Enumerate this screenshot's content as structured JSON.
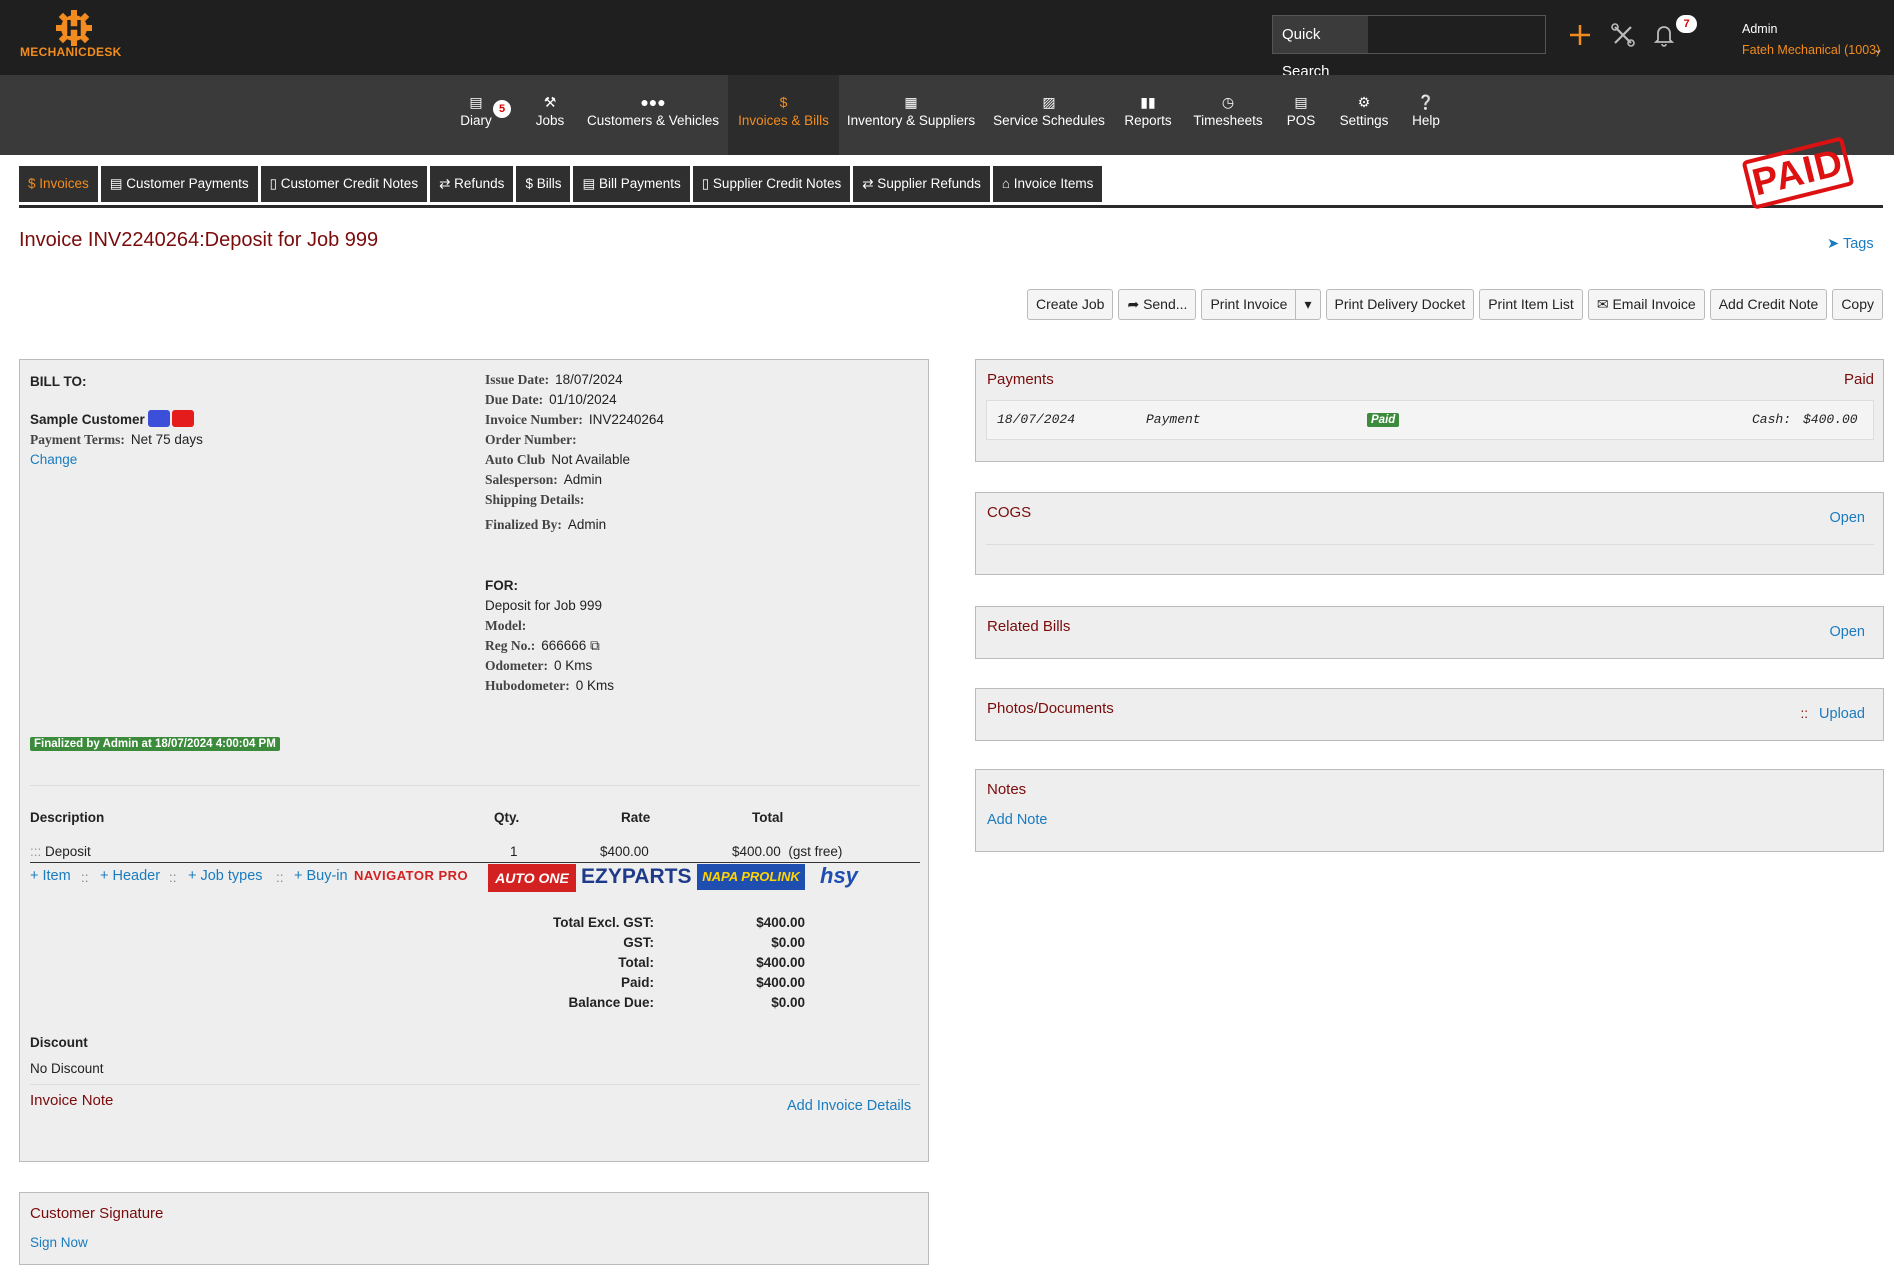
{
  "app": {
    "name": "MECHANICDESK"
  },
  "topbar": {
    "quick_search_label": "Quick Search",
    "quick_search_value": "",
    "notifications_count": "7",
    "user_name": "Admin",
    "company": "Fateh Mechanical (1003)"
  },
  "nav": {
    "items": [
      {
        "label": "Diary",
        "icon": "calendar-icon",
        "badge": "5"
      },
      {
        "label": "Jobs",
        "icon": "wrench-icon"
      },
      {
        "label": "Customers & Vehicles",
        "icon": "users-icon"
      },
      {
        "label": "Invoices & Bills",
        "icon": "dollar-icon",
        "active": true
      },
      {
        "label": "Inventory & Suppliers",
        "icon": "inventory-icon"
      },
      {
        "label": "Service Schedules",
        "icon": "clipboard-icon"
      },
      {
        "label": "Reports",
        "icon": "chart-icon"
      },
      {
        "label": "Timesheets",
        "icon": "clock-icon"
      },
      {
        "label": "POS",
        "icon": "store-icon"
      },
      {
        "label": "Settings",
        "icon": "gear-icon"
      },
      {
        "label": "Help",
        "icon": "help-icon"
      }
    ]
  },
  "subtabs": [
    {
      "label": "$ Invoices",
      "active": true
    },
    {
      "label": "▤ Customer Payments"
    },
    {
      "label": "▯ Customer Credit Notes"
    },
    {
      "label": "⇄ Refunds"
    },
    {
      "label": "$ Bills"
    },
    {
      "label": "▤ Bill Payments"
    },
    {
      "label": "▯ Supplier Credit Notes"
    },
    {
      "label": "⇄ Supplier Refunds"
    },
    {
      "label": "⌂ Invoice Items"
    }
  ],
  "stamp": "PAID",
  "page": {
    "title": "Invoice INV2240264:Deposit for Job 999",
    "tags_label": "Tags"
  },
  "actions": {
    "create_job": "Create Job",
    "send": "Send...",
    "print_invoice": "Print Invoice",
    "print_delivery_docket": "Print Delivery Docket",
    "print_item_list": "Print Item List",
    "email_invoice": "Email Invoice",
    "add_credit_note": "Add Credit Note",
    "copy": "Copy"
  },
  "invoice": {
    "bill_to_label": "BILL TO:",
    "customer_name": "Sample Customer",
    "payment_terms_label": "Payment Terms:",
    "payment_terms": "Net 75 days",
    "change_label": "Change",
    "details": {
      "issue_date_label": "Issue Date:",
      "issue_date": "18/07/2024",
      "due_date_label": "Due Date:",
      "due_date": "01/10/2024",
      "invoice_number_label": "Invoice Number:",
      "invoice_number": "INV2240264",
      "order_number_label": "Order Number:",
      "order_number": "",
      "auto_club_label": "Auto Club",
      "auto_club": "Not Available",
      "salesperson_label": "Salesperson:",
      "salesperson": "Admin",
      "shipping_label": "Shipping Details:",
      "shipping": "",
      "finalized_by_label": "Finalized By:",
      "finalized_by": "Admin"
    },
    "for": {
      "label": "FOR:",
      "description": "Deposit for Job 999",
      "model_label": "Model:",
      "model": "",
      "reg_label": "Reg No.:",
      "reg": "666666",
      "odometer_label": "Odometer:",
      "odometer": "0 Kms",
      "hubodometer_label": "Hubodometer:",
      "hubodometer": "0 Kms"
    },
    "finalized_badge": "Finalized by Admin at 18/07/2024 4:00:04 PM",
    "columns": {
      "description": "Description",
      "qty": "Qty.",
      "rate": "Rate",
      "total": "Total"
    },
    "lines": [
      {
        "description": "Deposit",
        "qty": "1",
        "rate": "$400.00",
        "total": "$400.00",
        "tax_note": "(gst free)"
      }
    ],
    "add_links": {
      "item": "+ Item",
      "header": "+ Header",
      "job_types": "+ Job types",
      "buy_in": "+ Buy-in",
      "sep": "::"
    },
    "supplier_logos": [
      "NAVIGATOR PRO",
      "AUTO ONE",
      "EZYPARTS",
      "NAPA PROLINK",
      "hsy"
    ],
    "totals": [
      {
        "label": "Total Excl. GST:",
        "value": "$400.00"
      },
      {
        "label": "GST:",
        "value": "$0.00"
      },
      {
        "label": "Total:",
        "value": "$400.00"
      },
      {
        "label": "Paid:",
        "value": "$400.00"
      },
      {
        "label": "Balance Due:",
        "value": "$0.00"
      }
    ],
    "discount_label": "Discount",
    "discount_value": "No Discount",
    "invoice_note_label": "Invoice Note",
    "add_invoice_details": "Add Invoice Details"
  },
  "signature": {
    "title": "Customer Signature",
    "sign_now": "Sign Now"
  },
  "payments": {
    "title": "Payments",
    "status": "Paid",
    "rows": [
      {
        "date": "18/07/2024",
        "type": "Payment",
        "badge": "Paid",
        "method": "Cash:",
        "amount": "$400.00"
      }
    ]
  },
  "cogs": {
    "title": "COGS",
    "action": "Open"
  },
  "related_bills": {
    "title": "Related Bills",
    "action": "Open"
  },
  "photos": {
    "title": "Photos/Documents",
    "sep": "::",
    "action": "Upload"
  },
  "notes": {
    "title": "Notes",
    "add_note": "Add Note"
  },
  "colors": {
    "brand_orange": "#f28c1e",
    "title_red": "#7a0b0b",
    "link_blue": "#1a7bbf",
    "paid_green": "#3c8b3c",
    "stamp_red": "#dd1111"
  }
}
